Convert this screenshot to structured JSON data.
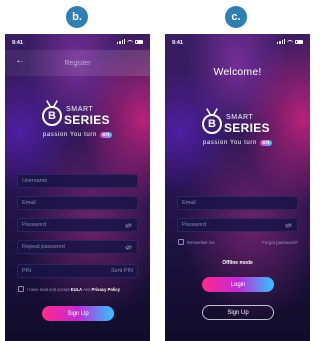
{
  "labels": {
    "panel_b": "b.",
    "panel_c": "c."
  },
  "status": {
    "time": "9:41"
  },
  "brand": {
    "smart": "SMART",
    "series": "SERIES",
    "mark": "B",
    "tagline": "passion You turn",
    "on": "on"
  },
  "register": {
    "title": "Register",
    "fields": {
      "username": "Username",
      "email": "Email",
      "password": "Password",
      "repeat_password": "Repeat password",
      "pin": "PIN",
      "sent_pin": "Sent PIN"
    },
    "agree_prefix": "I have read and accept",
    "agree_eula": "EULA",
    "agree_and": "and",
    "agree_privacy": "Privacy Policy",
    "signup_label": "Sign Up"
  },
  "login": {
    "welcome": "Welcome!",
    "fields": {
      "email": "Email",
      "password": "Password"
    },
    "remember_me": "Remember me",
    "forgot_password": "Forgot password?",
    "offline_mode": "Offline mode",
    "login_label": "Login",
    "signup_label": "Sign Up"
  },
  "colors": {
    "badge": "#2f7fb3",
    "accent_pink": "#ff2a8d",
    "accent_cyan": "#2fc6ff"
  }
}
